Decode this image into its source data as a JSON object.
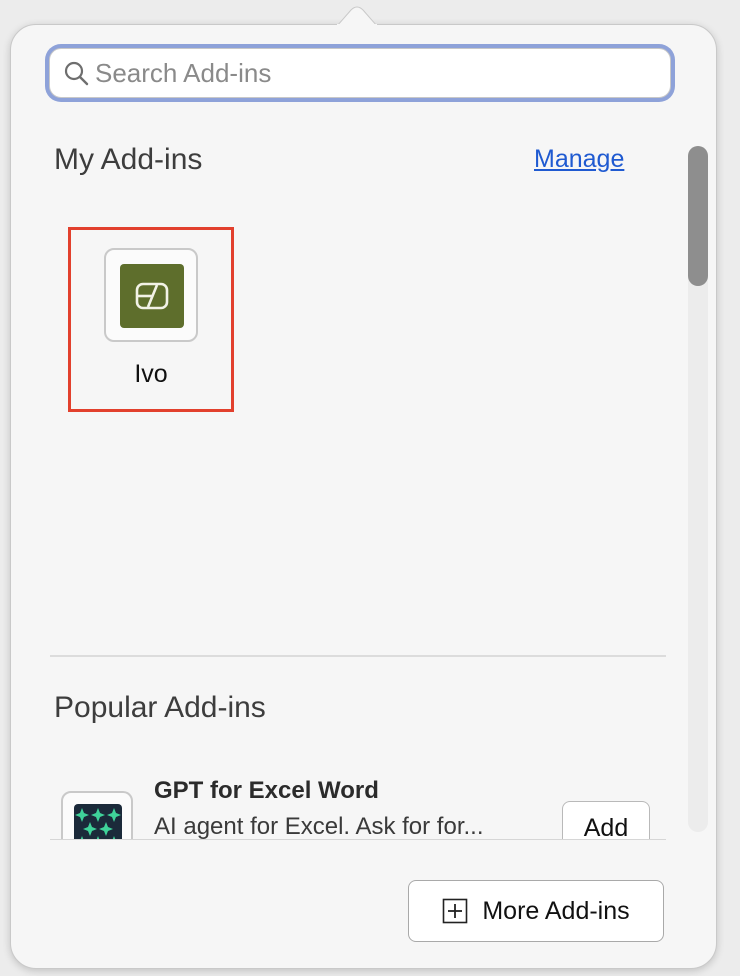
{
  "search": {
    "placeholder": "Search Add-ins",
    "value": "",
    "icon": "search-icon"
  },
  "my_addins": {
    "title": "My Add-ins",
    "manage_label": "Manage",
    "items": [
      {
        "name": "Ivo",
        "icon": "ivo-logo-icon",
        "color": "#5e6e2c"
      }
    ]
  },
  "popular_addins": {
    "title": "Popular Add-ins",
    "items": [
      {
        "name": "GPT for Excel Word",
        "description": "AI agent for Excel. Ask for for...",
        "add_label": "Add",
        "icon": "gpt-for-excel-word-logo-icon"
      }
    ]
  },
  "footer": {
    "more_label": "More Add-ins",
    "more_icon": "plus-box-icon"
  },
  "colors": {
    "focus_ring": "#8ea2d9",
    "link": "#1f5ad1",
    "highlight_box": "#e2402d"
  }
}
